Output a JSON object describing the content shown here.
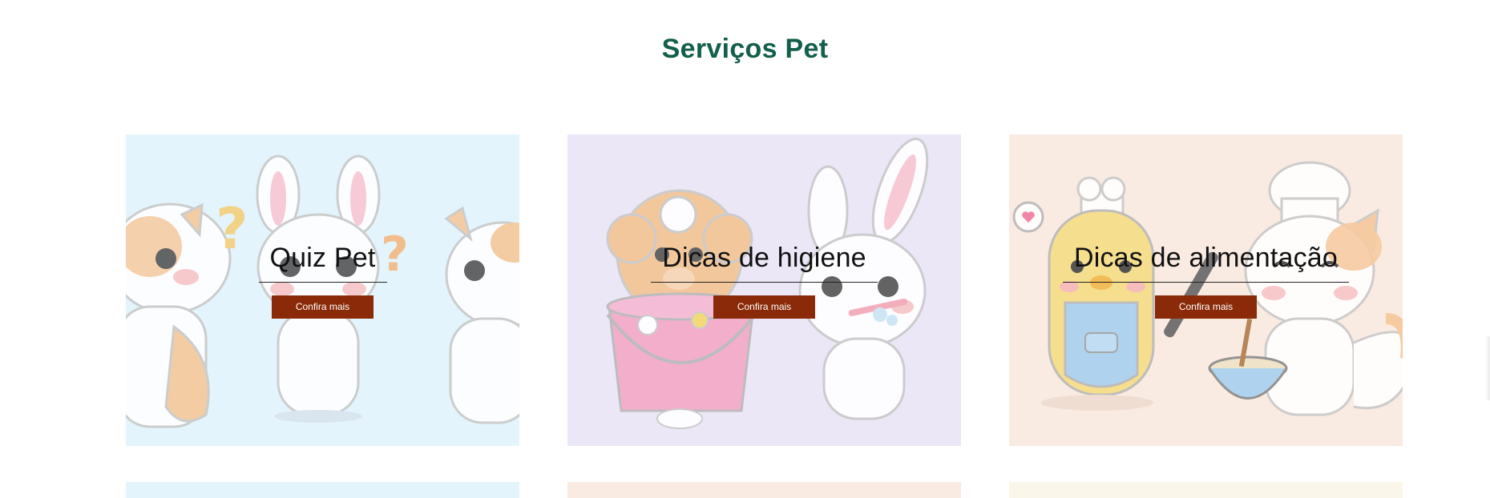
{
  "section": {
    "title": "Serviços Pet"
  },
  "cards": [
    {
      "title": "Quiz Pet",
      "button": "Confira mais",
      "color": "#e4f4fc",
      "illustration": "confused-cats-and-bunny"
    },
    {
      "title": "Dicas de higiene",
      "button": "Confira mais",
      "color": "#ebe7f6",
      "illustration": "dog-in-bucket-and-bunny-brushing-teeth"
    },
    {
      "title": "Dicas de alimentação",
      "button": "Confira mais",
      "color": "#f9ebe2",
      "illustration": "chick-and-cat-chefs"
    }
  ],
  "colors": {
    "title": "#135f4c",
    "button": "#8a2a08"
  }
}
